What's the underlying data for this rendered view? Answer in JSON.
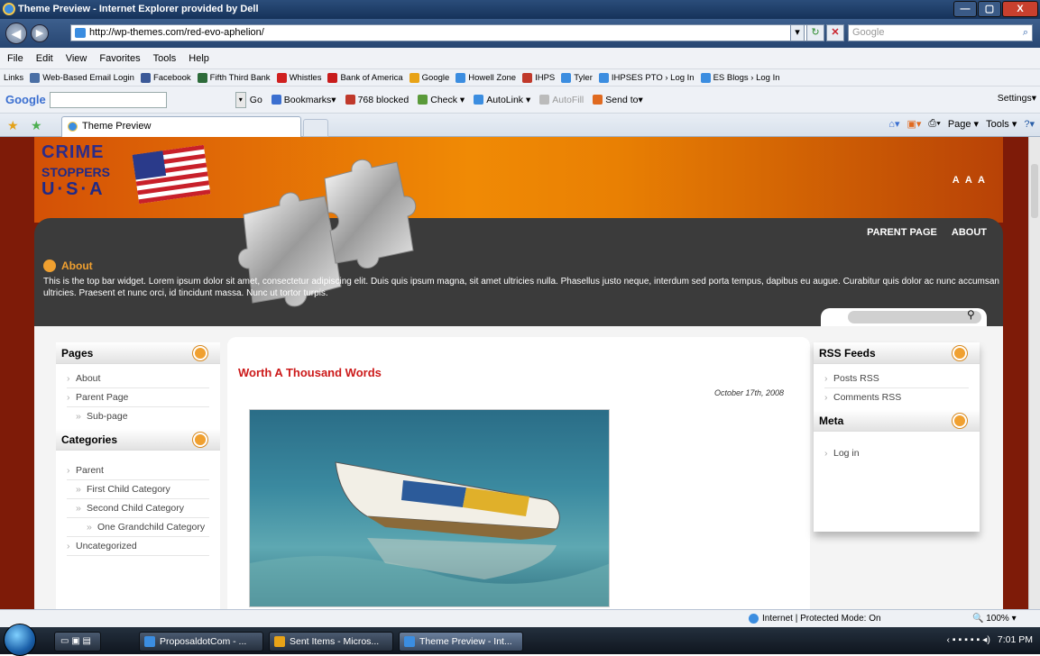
{
  "window": {
    "title": "Theme Preview - Internet Explorer provided by Dell",
    "min": "—",
    "max": "▢",
    "close": "X"
  },
  "address": {
    "url": "http://wp-themes.com/red-evo-aphelion/",
    "search_placeholder": "Google",
    "back": "◀",
    "forward": "▶",
    "search_icon": "⌕"
  },
  "menu": [
    "File",
    "Edit",
    "View",
    "Favorites",
    "Tools",
    "Help"
  ],
  "links": {
    "label": "Links",
    "items": [
      {
        "label": "Web-Based Email Login",
        "color": "#4a6fa5"
      },
      {
        "label": "Facebook",
        "color": "#3b5998"
      },
      {
        "label": "Fifth Third Bank",
        "color": "#2d6b3a"
      },
      {
        "label": "Whistles",
        "color": "#d02020"
      },
      {
        "label": "Bank of America",
        "color": "#c81c1c"
      },
      {
        "label": "Google",
        "color": "#e8a317"
      },
      {
        "label": "Howell Zone",
        "color": "#3b8de0"
      },
      {
        "label": "IHPS",
        "color": "#c0392b"
      },
      {
        "label": "Tyler",
        "color": "#3b8de0"
      },
      {
        "label": "IHPSES PTO › Log In",
        "color": "#3b8de0"
      },
      {
        "label": "ES Blogs › Log In",
        "color": "#3b8de0"
      }
    ]
  },
  "googlebar": {
    "brand": "Google",
    "go": "Go",
    "items": [
      "Bookmarks▾",
      "768 blocked",
      "Check ▾",
      "AutoLink ▾",
      "AutoFill",
      "Send to▾"
    ],
    "settings": "Settings▾"
  },
  "tab": {
    "label": "Theme Preview"
  },
  "commandbar": [
    "Page ▾",
    "Tools ▾"
  ],
  "site": {
    "logo": {
      "line1": "CRIME",
      "line2": "STOPPERS",
      "line3": "U·S·A"
    },
    "text_size": "A A A",
    "nav": [
      "PARENT PAGE",
      "ABOUT"
    ],
    "about": {
      "title": "About",
      "text": "This is the top bar widget. Lorem ipsum dolor sit amet, consectetur adipiscing elit. Duis quis ipsum magna, sit amet ultricies nulla. Phasellus justo neque, interdum sed porta tempus, dapibus eu augue. Curabitur quis dolor ac nunc accumsan ultricies. Praesent et nunc orci, id tincidunt massa. Nunc ut tortor turpis."
    },
    "pages": {
      "title": "Pages",
      "items": [
        "About",
        "Parent Page",
        "Sub-page"
      ]
    },
    "categories": {
      "title": "Categories",
      "items": [
        "Parent",
        "First Child Category",
        "Second Child Category",
        "One Grandchild Category",
        "Uncategorized"
      ]
    },
    "post": {
      "title": "Worth A Thousand Words",
      "date": "October 17th, 2008"
    },
    "rss": {
      "title": "RSS Feeds",
      "items": [
        "Posts RSS",
        "Comments RSS"
      ]
    },
    "meta": {
      "title": "Meta",
      "items": [
        "Log in"
      ]
    }
  },
  "status": {
    "zone": "Internet | Protected Mode: On",
    "zoom": "100%"
  },
  "taskbar": {
    "buttons": [
      "ProposaldotCom - ...",
      "Sent Items - Micros...",
      "Theme Preview - Int..."
    ],
    "time": "7:01 PM"
  }
}
